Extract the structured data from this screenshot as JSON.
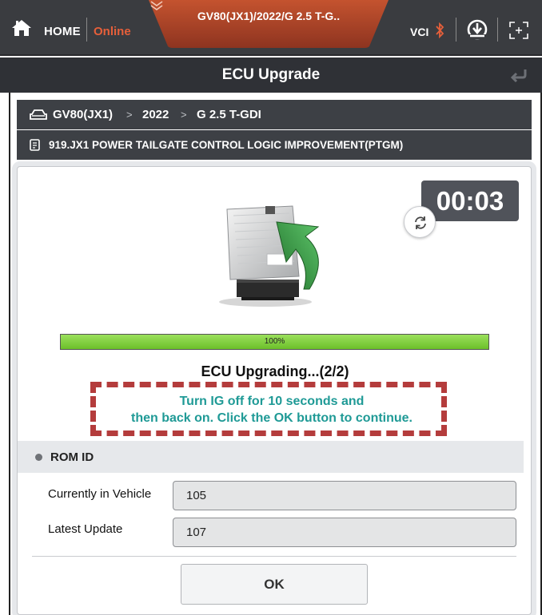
{
  "header": {
    "home_label": "HOME",
    "status_label": "Online",
    "vehicle_title": "GV80(JX1)/2022/G 2.5 T-G..",
    "vci_label": "VCI",
    "colors": {
      "online": "#e65f3a",
      "tab_accent": "#b4442c",
      "bar": "#3a3c40"
    },
    "icons": [
      "home-icon",
      "chevron-down-icon",
      "bluetooth-icon",
      "download-icon",
      "fullscreen-icon"
    ]
  },
  "title_bar": {
    "title": "ECU Upgrade",
    "icons": [
      "back-icon"
    ]
  },
  "breadcrumb": {
    "items": [
      "GV80(JX1)",
      "2022",
      "G 2.5 T-GDI"
    ],
    "separator": ">",
    "icon": "car-icon"
  },
  "document": {
    "title": "919.JX1 POWER TAILGATE CONTROL LOGIC IMPROVEMENT(PTGM)",
    "icon": "document-icon"
  },
  "upgrade": {
    "timer": "00:03",
    "progress_percent": 100,
    "progress_label": "100%",
    "status": "ECU Upgrading...(2/2)",
    "instruction_line1": "Turn IG off for 10 seconds and",
    "instruction_line2": "then back on. Click the OK button to continue.",
    "colors": {
      "instruction": "#1f9a96",
      "highlight_border": "#b43c3c",
      "progress": "#7fcf3a"
    }
  },
  "rom_id": {
    "section_title": "ROM ID",
    "rows": [
      {
        "label": "Currently in Vehicle",
        "value": "105"
      },
      {
        "label": "Latest Update",
        "value": "107"
      }
    ]
  },
  "actions": {
    "ok_label": "OK"
  }
}
